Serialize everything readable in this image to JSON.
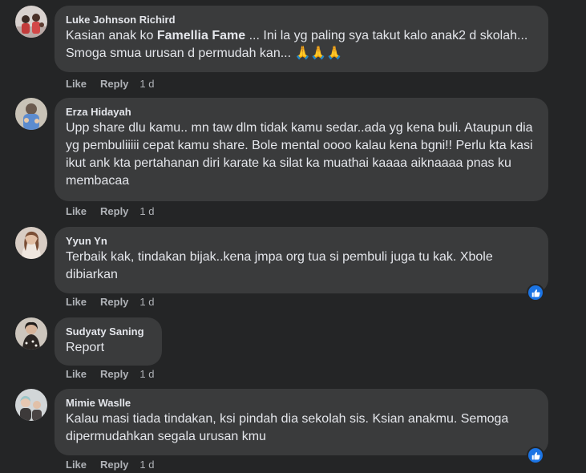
{
  "comments": [
    {
      "author": "Luke Johnson Richird",
      "text_pre": "Kasian anak ko ",
      "mention": "Famellia Fame",
      "text_post": " ... Ini la yg paling sya takut kalo anak2 d skolah... Smoga smua urusan d permudah kan... 🙏🙏🙏",
      "like": "Like",
      "reply": "Reply",
      "time": "1 d",
      "reaction": null
    },
    {
      "author": "Erza Hidayah",
      "text": "Upp share dlu kamu.. mn taw dlm tidak kamu sedar..ada yg kena buli. Ataupun dia yg pembuliiiii cepat kamu share. Bole mental oooo kalau kena bgni!! Perlu kta kasi ikut ank kta pertahanan diri karate ka silat ka muathai kaaaa aiknaaaa pnas ku membacaa",
      "like": "Like",
      "reply": "Reply",
      "time": "1 d",
      "reaction": null
    },
    {
      "author": "Yyun Yn",
      "text": "Terbaik kak, tindakan bijak..kena jmpa org tua si pembuli juga tu kak. Xbole dibiarkan",
      "like": "Like",
      "reply": "Reply",
      "time": "1 d",
      "reaction": "like-reaction-icon"
    },
    {
      "author": "Sudyaty Saning",
      "text": "Report",
      "like": "Like",
      "reply": "Reply",
      "time": "1 d",
      "reaction": null
    },
    {
      "author": "Mimie Waslle",
      "text": "Kalau masi tiada tindakan, ksi pindah dia sekolah sis. Ksian anakmu. Semoga dipermudahkan segala urusan kmu",
      "like": "Like",
      "reply": "Reply",
      "time": "1 d",
      "reaction": "like-reaction-icon"
    }
  ],
  "colors": {
    "background": "#242526",
    "bubble": "#3a3b3c",
    "primary_text": "#e4e6eb",
    "secondary_text": "#b0b3b8",
    "like_blue": "#1b74e4"
  }
}
